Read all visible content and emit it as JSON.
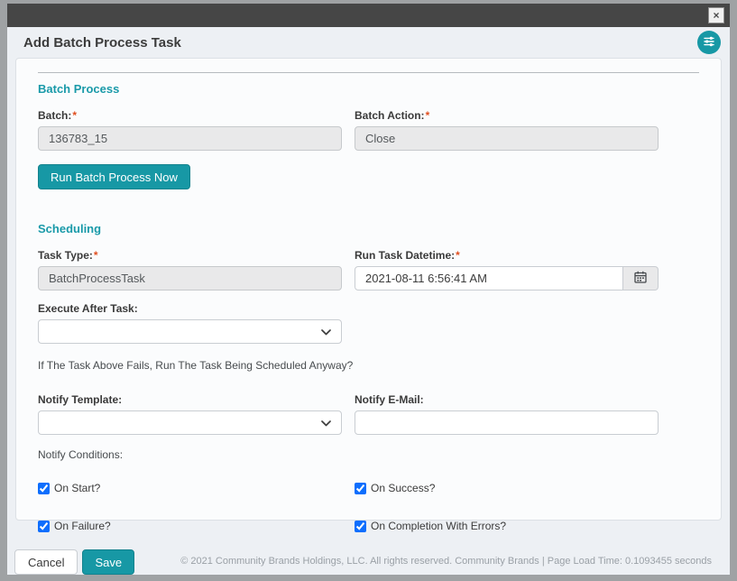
{
  "window": {
    "close_glyph": "×"
  },
  "header": {
    "title": "Add Batch Process Task"
  },
  "batch_process": {
    "title": "Batch Process",
    "required_marker": "*",
    "batch_label": "Batch:",
    "batch_value": "136783_15",
    "batch_action_label": "Batch Action:",
    "batch_action_value": "Close",
    "run_button_label": "Run Batch Process Now"
  },
  "scheduling": {
    "title": "Scheduling",
    "required_marker": "*",
    "task_type_label": "Task Type:",
    "task_type_value": "BatchProcessTask",
    "run_task_datetime_label": "Run Task Datetime:",
    "run_task_datetime_value": "2021-08-11 6:56:41 AM",
    "execute_after_task_label": "Execute After Task:",
    "execute_after_task_value": "",
    "fail_question": "If The Task Above Fails, Run The Task Being Scheduled Anyway?",
    "notify_template_label": "Notify Template:",
    "notify_template_value": "",
    "notify_email_label": "Notify E-Mail:",
    "notify_email_value": "",
    "notify_conditions_label": "Notify Conditions:",
    "checkboxes": [
      {
        "label": "On Start?",
        "checked": true
      },
      {
        "label": "On Success?",
        "checked": true
      },
      {
        "label": "On Failure?",
        "checked": true
      },
      {
        "label": "On Completion With Errors?",
        "checked": true
      }
    ]
  },
  "footer": {
    "cancel_label": "Cancel",
    "save_label": "Save",
    "copyright": "© 2021 Community Brands Holdings, LLC. All rights reserved. Community Brands | Page Load Time: 0.1093455 seconds"
  }
}
